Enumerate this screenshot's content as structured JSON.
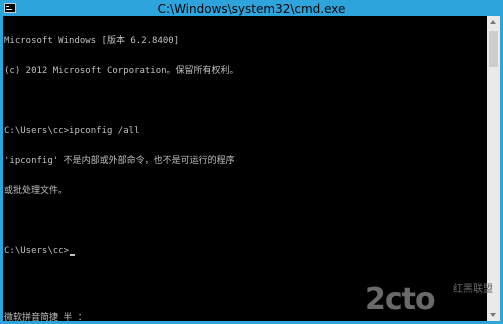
{
  "window": {
    "title": "C:\\Windows\\system32\\cmd.exe",
    "icon": "cmd-console-icon"
  },
  "console": {
    "lines": [
      "Microsoft Windows [版本 6.2.8400]",
      "(c) 2012 Microsoft Corporation。保留所有权利。",
      "",
      "C:\\Users\\cc>ipconfig /all",
      "'ipconfig' 不是内部或外部命令，也不是可运行的程序",
      "或批处理文件。",
      "",
      "C:\\Users\\cc>"
    ],
    "ime_status": "微软拼音简捷 半 ："
  },
  "colors": {
    "chrome": "#2ea4dd",
    "console_bg": "#000000",
    "console_text": "#c0c0c0"
  },
  "watermark": {
    "logo_text": "2cto",
    "logo_sub": "红黑联盟"
  }
}
